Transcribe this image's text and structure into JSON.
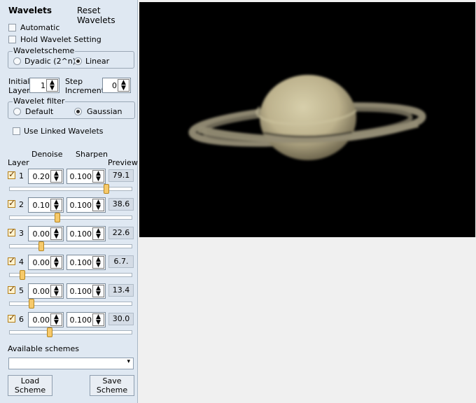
{
  "panel": {
    "title": "Wavelets",
    "reset_label": "Reset Wavelets",
    "automatic_label": "Automatic",
    "hold_label": "Hold Wavelet Setting",
    "wavelet_scheme": {
      "legend": "Waveletscheme",
      "options": [
        "Dyadic (2^n)",
        "Linear"
      ],
      "selected": "Linear"
    },
    "initial_layer_label": "Initial\nLayer",
    "initial_layer_value": "1",
    "step_increment_label": "Step\nIncrement",
    "step_increment_value": "0",
    "wavelet_filter": {
      "legend": "Wavelet filter",
      "options": [
        "Default",
        "Gaussian"
      ],
      "selected": "Gaussian"
    },
    "linked_label": "Use Linked Wavelets",
    "headers": {
      "layer": "Layer",
      "denoise": "Denoise",
      "sharpen": "Sharpen",
      "preview": "Preview"
    },
    "layers": [
      {
        "num": "1",
        "denoise": "0.20",
        "sharpen": "0.100",
        "preview": "79.1",
        "slider": 0.79,
        "checked": true
      },
      {
        "num": "2",
        "denoise": "0.10",
        "sharpen": "0.100",
        "preview": "38.6",
        "slider": 0.39,
        "checked": true
      },
      {
        "num": "3",
        "denoise": "0.00",
        "sharpen": "0.100",
        "preview": "22.6",
        "slider": 0.26,
        "checked": true
      },
      {
        "num": "4",
        "denoise": "0.00",
        "sharpen": "0.100",
        "preview": "6.7.",
        "slider": 0.11,
        "checked": true
      },
      {
        "num": "5",
        "denoise": "0.00",
        "sharpen": "0.100",
        "preview": "13.4",
        "slider": 0.18,
        "checked": true
      },
      {
        "num": "6",
        "denoise": "0.00",
        "sharpen": "0.100",
        "preview": "30.0",
        "slider": 0.33,
        "checked": true
      }
    ],
    "available_schemes_label": "Available schemes",
    "scheme_value": "",
    "load_label": "Load\nScheme",
    "save_label": "Save\nScheme"
  }
}
